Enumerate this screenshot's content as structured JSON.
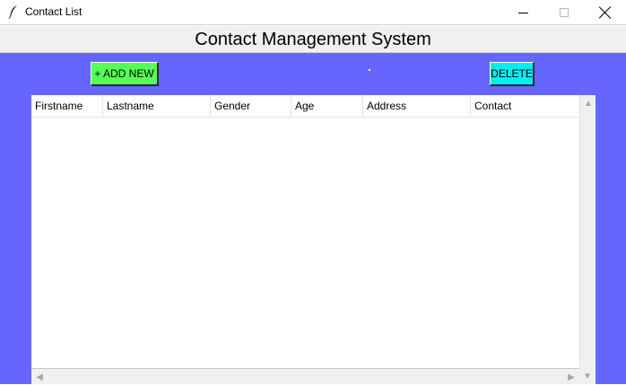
{
  "window": {
    "title": "Contact List",
    "icon": "feather-icon",
    "controls": [
      "minimize",
      "maximize",
      "close"
    ]
  },
  "header": {
    "title": "Contact Management System"
  },
  "toolbar": {
    "add_label": "+ ADD NEW",
    "delete_label": "DELETE"
  },
  "table": {
    "columns": [
      "Firstname",
      "Lastname",
      "Gender",
      "Age",
      "Address",
      "Contact"
    ],
    "rows": []
  },
  "colors": {
    "main_background": "#6666ff",
    "add_button": "#55ff55",
    "delete_button": "#00eeee"
  }
}
